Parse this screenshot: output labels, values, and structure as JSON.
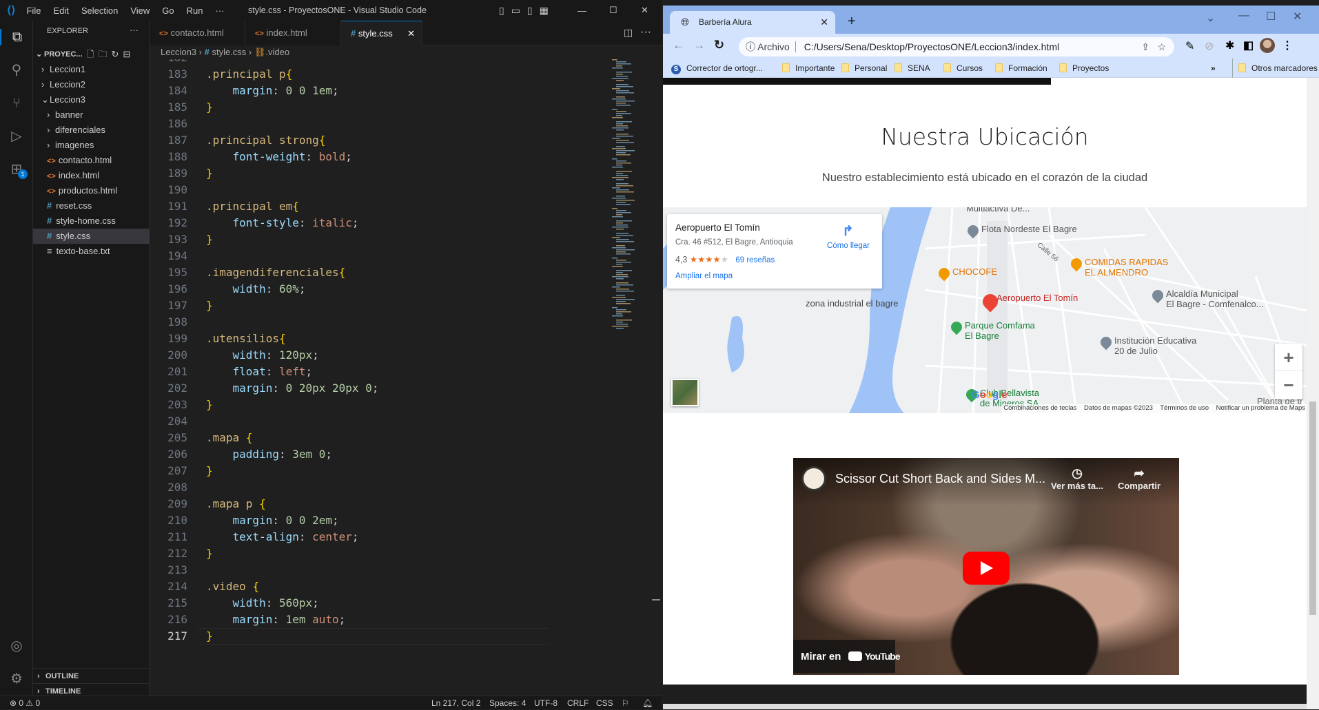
{
  "vscode": {
    "menu": [
      "File",
      "Edit",
      "Selection",
      "View",
      "Go",
      "Run",
      "···"
    ],
    "title": "style.css - ProyectosONE - Visual Studio Code",
    "explorer": {
      "title": "EXPLORER",
      "more": "···",
      "root": "PROYEC...",
      "items": [
        {
          "label": "Leccion1",
          "type": "folder",
          "level": 0,
          "open": false
        },
        {
          "label": "Leccion2",
          "type": "folder",
          "level": 0,
          "open": false
        },
        {
          "label": "Leccion3",
          "type": "folder",
          "level": 0,
          "open": true
        },
        {
          "label": "banner",
          "type": "folder",
          "level": 1,
          "open": false
        },
        {
          "label": "diferenciales",
          "type": "folder",
          "level": 1,
          "open": false
        },
        {
          "label": "imagenes",
          "type": "folder",
          "level": 1,
          "open": false
        },
        {
          "label": "contacto.html",
          "type": "html",
          "level": 1
        },
        {
          "label": "index.html",
          "type": "html",
          "level": 1
        },
        {
          "label": "productos.html",
          "type": "html",
          "level": 1
        },
        {
          "label": "reset.css",
          "type": "css",
          "level": 1
        },
        {
          "label": "style-home.css",
          "type": "css",
          "level": 1
        },
        {
          "label": "style.css",
          "type": "css",
          "level": 1,
          "selected": true
        },
        {
          "label": "texto-base.txt",
          "type": "txt",
          "level": 1
        }
      ],
      "outline": "OUTLINE",
      "timeline": "TIMELINE"
    },
    "accounts_badge": "1",
    "tabs": [
      {
        "label": "contacto.html",
        "icon": "html"
      },
      {
        "label": "index.html",
        "icon": "html"
      },
      {
        "label": "style.css",
        "icon": "css",
        "active": true
      }
    ],
    "breadcrumb": [
      "Leccion3",
      "style.css",
      ".video"
    ],
    "code": [
      {
        "n": 183,
        "t": [
          [
            ".principal p",
            "s"
          ],
          [
            "{",
            "b"
          ]
        ]
      },
      {
        "n": 184,
        "t": [
          [
            "    margin",
            "p"
          ],
          [
            ": ",
            ""
          ],
          [
            "0 0 1em",
            "n"
          ],
          [
            ";",
            ""
          ]
        ]
      },
      {
        "n": 185,
        "t": [
          [
            "}",
            "b"
          ]
        ]
      },
      {
        "n": 186,
        "t": []
      },
      {
        "n": 187,
        "t": [
          [
            ".principal strong",
            "s"
          ],
          [
            "{",
            "b"
          ]
        ]
      },
      {
        "n": 188,
        "t": [
          [
            "    font-weight",
            "p"
          ],
          [
            ": ",
            ""
          ],
          [
            "bold",
            "v"
          ],
          [
            ";",
            ""
          ]
        ]
      },
      {
        "n": 189,
        "t": [
          [
            "}",
            "b"
          ]
        ]
      },
      {
        "n": 190,
        "t": []
      },
      {
        "n": 191,
        "t": [
          [
            ".principal em",
            "s"
          ],
          [
            "{",
            "b"
          ]
        ]
      },
      {
        "n": 192,
        "t": [
          [
            "    font-style",
            "p"
          ],
          [
            ": ",
            ""
          ],
          [
            "italic",
            "v"
          ],
          [
            ";",
            ""
          ]
        ]
      },
      {
        "n": 193,
        "t": [
          [
            "}",
            "b"
          ]
        ]
      },
      {
        "n": 194,
        "t": []
      },
      {
        "n": 195,
        "t": [
          [
            ".imagendiferenciales",
            "s"
          ],
          [
            "{",
            "b"
          ]
        ]
      },
      {
        "n": 196,
        "t": [
          [
            "    width",
            "p"
          ],
          [
            ": ",
            ""
          ],
          [
            "60%",
            "n"
          ],
          [
            ";",
            ""
          ]
        ]
      },
      {
        "n": 197,
        "t": [
          [
            "}",
            "b"
          ]
        ]
      },
      {
        "n": 198,
        "t": []
      },
      {
        "n": 199,
        "t": [
          [
            ".utensilios",
            "s"
          ],
          [
            "{",
            "b"
          ]
        ]
      },
      {
        "n": 200,
        "t": [
          [
            "    width",
            "p"
          ],
          [
            ": ",
            ""
          ],
          [
            "120px",
            "n"
          ],
          [
            ";",
            ""
          ]
        ]
      },
      {
        "n": 201,
        "t": [
          [
            "    float",
            "p"
          ],
          [
            ": ",
            ""
          ],
          [
            "left",
            "v"
          ],
          [
            ";",
            ""
          ]
        ]
      },
      {
        "n": 202,
        "t": [
          [
            "    margin",
            "p"
          ],
          [
            ": ",
            ""
          ],
          [
            "0 20px 20px 0",
            "n"
          ],
          [
            ";",
            ""
          ]
        ]
      },
      {
        "n": 203,
        "t": [
          [
            "}",
            "b"
          ]
        ]
      },
      {
        "n": 204,
        "t": []
      },
      {
        "n": 205,
        "t": [
          [
            ".mapa ",
            "s"
          ],
          [
            "{",
            "b"
          ]
        ]
      },
      {
        "n": 206,
        "t": [
          [
            "    padding",
            "p"
          ],
          [
            ": ",
            ""
          ],
          [
            "3em 0",
            "n"
          ],
          [
            ";",
            ""
          ]
        ]
      },
      {
        "n": 207,
        "t": [
          [
            "}",
            "b"
          ]
        ]
      },
      {
        "n": 208,
        "t": []
      },
      {
        "n": 209,
        "t": [
          [
            ".mapa p ",
            "s"
          ],
          [
            "{",
            "b"
          ]
        ]
      },
      {
        "n": 210,
        "t": [
          [
            "    margin",
            "p"
          ],
          [
            ": ",
            ""
          ],
          [
            "0 0 2em",
            "n"
          ],
          [
            ";",
            ""
          ]
        ]
      },
      {
        "n": 211,
        "t": [
          [
            "    text-align",
            "p"
          ],
          [
            ": ",
            ""
          ],
          [
            "center",
            "v"
          ],
          [
            ";",
            ""
          ]
        ]
      },
      {
        "n": 212,
        "t": [
          [
            "}",
            "b"
          ]
        ]
      },
      {
        "n": 213,
        "t": []
      },
      {
        "n": 214,
        "t": [
          [
            ".video ",
            "s"
          ],
          [
            "{",
            "b"
          ]
        ]
      },
      {
        "n": 215,
        "t": [
          [
            "    width",
            "p"
          ],
          [
            ": ",
            ""
          ],
          [
            "560px",
            "n"
          ],
          [
            ";",
            ""
          ]
        ]
      },
      {
        "n": 216,
        "t": [
          [
            "    margin",
            "p"
          ],
          [
            ": ",
            ""
          ],
          [
            "1em ",
            "n"
          ],
          [
            "auto",
            "v"
          ],
          [
            ";",
            ""
          ]
        ]
      },
      {
        "n": 217,
        "t": [
          [
            "}",
            "b"
          ]
        ],
        "current": true
      }
    ],
    "status": {
      "errors": "0",
      "warnings": "0",
      "position": "Ln 217, Col 2",
      "spaces": "Spaces: 4",
      "encoding": "UTF-8",
      "eol": "CRLF",
      "language": "CSS"
    },
    "colors": {
      "selector": "#d7ba7d",
      "bracket": "#ffd700",
      "property": "#9cdcfe",
      "number": "#b5cea8",
      "value": "#ce9178",
      "accent": "#0078d4"
    }
  },
  "browser": {
    "tab_title": "Barbería Alura",
    "address_prefix": "Archivo",
    "url": "C:/Users/Sena/Desktop/ProyectosONE/Leccion3/index.html",
    "bookmarks": [
      "Corrector de ortogr...",
      "Importante",
      "Personal",
      "SENA",
      "Cursos",
      "Formación",
      "Proyectos"
    ],
    "bookmarks_more": "»",
    "other_bookmarks": "Otros marcadores",
    "page": {
      "heading": "Nuestra Ubicación",
      "subtitle": "Nuestro establecimiento está ubicado en el corazón de la ciudad",
      "map": {
        "place_name": "Aeropuerto El Tomín",
        "address": "Cra. 46 #512, El Bagre, Antioquia",
        "rating": "4,3",
        "stars": 4.3,
        "reviews": "69 reseñas",
        "directions": "Cómo llegar",
        "enlarge": "Ampliar el mapa",
        "labels": {
          "flota": "Flota Nordeste El Bagre",
          "chocofe": "CHOCOFE",
          "comidas": "COMIDAS RAPIDAS\nEL ALMENDRO",
          "aeropuerto": "Aeropuerto El Tomín",
          "alcaldia": "Alcaldía Municipal\nEl Bagre - Comfenalco...",
          "zona": "zona industrial el bagre",
          "parque": "Parque Comfama\nEl Bagre",
          "institucion": "Institución Educativa\n20 de Julio",
          "club": "Club Bellavista\nde Mineros SA",
          "street": "Calle 56",
          "top_partial": "Multiactiva De...",
          "planta": "Planta de tr"
        },
        "footer": [
          "Combinaciones de teclas",
          "Datos de mapas ©2023",
          "Términos de uso",
          "Notificar un problema de Maps"
        ],
        "zoom_in": "+",
        "zoom_out": "−"
      },
      "video": {
        "title": "Scissor Cut Short Back and Sides M...",
        "watch_later": "Ver más ta...",
        "share": "Compartir",
        "watch_on": "Mirar en",
        "youtube": "YouTube"
      }
    }
  }
}
